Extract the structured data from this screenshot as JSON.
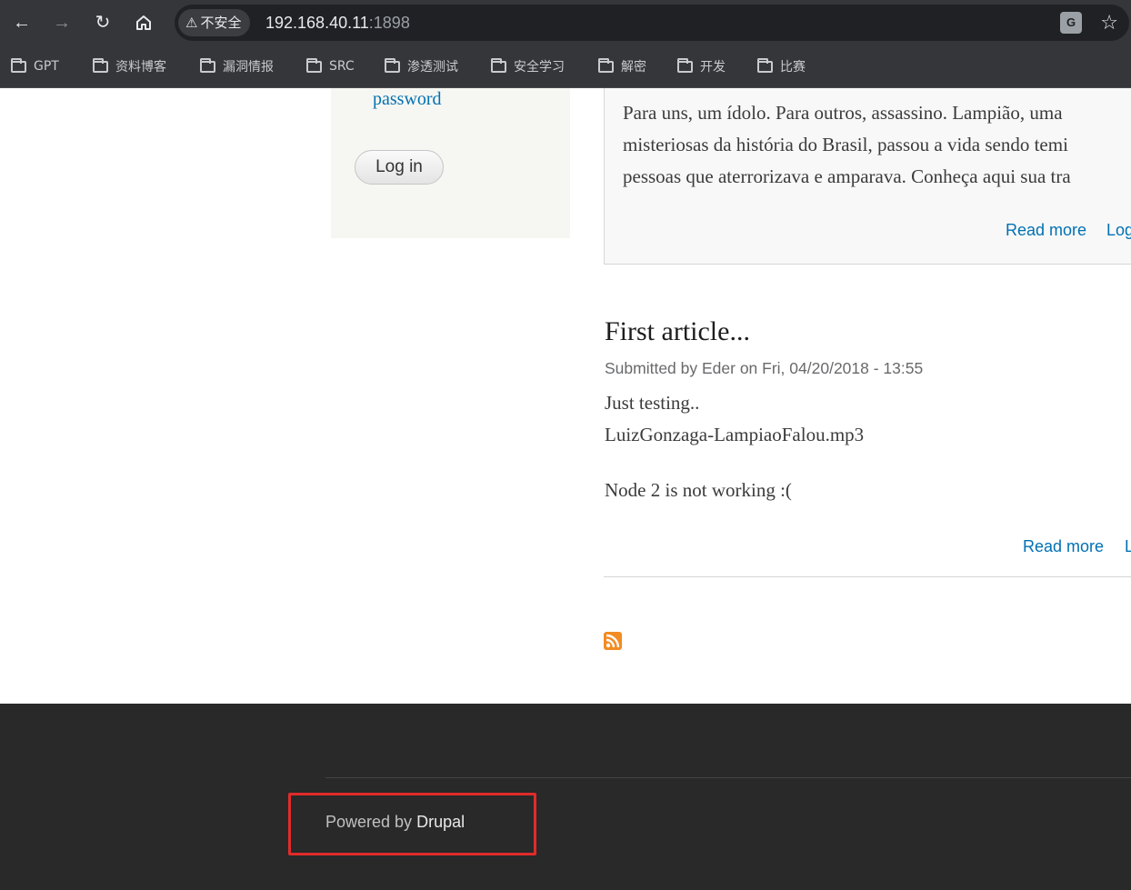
{
  "browser": {
    "security_label": "不安全",
    "url_host": "192.168.40.11",
    "url_port": ":1898",
    "bookmarks": [
      "GPT",
      "资料博客",
      "漏洞情报",
      "SRC",
      "渗透测试",
      "安全学习",
      "解密",
      "开发",
      "比赛"
    ]
  },
  "login": {
    "password_link": "password",
    "login_button": "Log in"
  },
  "teaser": {
    "lines": [
      "Para uns, um ídolo. Para outros, assassino. Lampião, uma",
      "misteriosas da história do Brasil, passou a vida sendo temi",
      "pessoas que aterrorizava e amparava. Conheça aqui sua tra"
    ],
    "read_more": "Read more",
    "log_in": "Log"
  },
  "article": {
    "title": "First article...",
    "submitted": "Submitted by Eder on Fri, 04/20/2018 - 13:55",
    "body": [
      "Just testing..",
      "LuizGonzaga-LampiaoFalou.mp3",
      "Node 2 is not working :("
    ],
    "read_more": "Read more",
    "log_in": "L"
  },
  "footer": {
    "powered_by": "Powered by",
    "drupal": "Drupal"
  },
  "colors": {
    "link": "#0071b3",
    "footer_bg": "#292929",
    "highlight": "#e02b2b",
    "rss": "#f38b22"
  }
}
